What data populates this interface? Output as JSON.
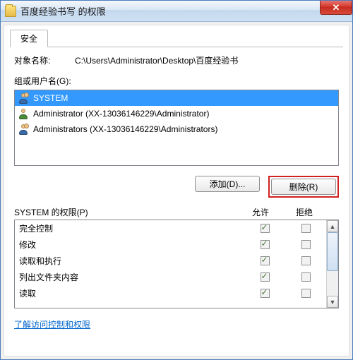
{
  "window": {
    "title": "百度经验书写 的权限"
  },
  "tab": {
    "security": "安全"
  },
  "object": {
    "label": "对象名称:",
    "path": "C:\\Users\\Administrator\\Desktop\\百度经验书"
  },
  "groups": {
    "label": "组或用户名(G):",
    "items": [
      {
        "name": "SYSTEM",
        "type": "multi",
        "selected": true
      },
      {
        "name": "Administrator (XX-13036146229\\Administrator)",
        "type": "single",
        "selected": false
      },
      {
        "name": "Administrators (XX-13036146229\\Administrators)",
        "type": "multi",
        "selected": false
      }
    ]
  },
  "buttons": {
    "add": "添加(D)...",
    "remove": "删除(R)"
  },
  "perm_header": {
    "label": "SYSTEM 的权限(P)",
    "allow": "允许",
    "deny": "拒绝"
  },
  "permissions": [
    {
      "name": "完全控制",
      "allow": true,
      "deny": false
    },
    {
      "name": "修改",
      "allow": true,
      "deny": false
    },
    {
      "name": "读取和执行",
      "allow": true,
      "deny": false
    },
    {
      "name": "列出文件夹内容",
      "allow": true,
      "deny": false
    },
    {
      "name": "读取",
      "allow": true,
      "deny": false
    }
  ],
  "link": "了解访问控制和权限"
}
